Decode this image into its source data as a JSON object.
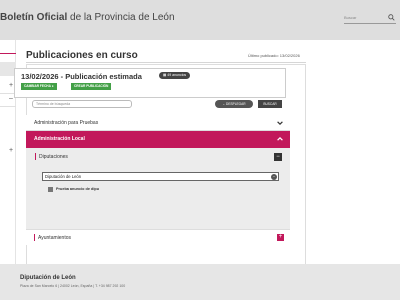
{
  "header": {
    "title_bold": "Boletín Oficial",
    "title_rest": " de la Provincia de León",
    "search_placeholder": "Buscar"
  },
  "sidebar": {
    "symbols": [
      "+",
      "–",
      "+"
    ]
  },
  "main": {
    "title": "Publicaciones en curso",
    "last_publication": "Último publicado: 13/02/2026",
    "card": {
      "date_title": "13/02/2026 - Publicación estimada",
      "count_badge": "49 anuncios",
      "change_date": "CAMBIAR FECHA",
      "create_pub": "CREAR PUBLICACIÓN"
    },
    "filter_placeholder": "Término de búsqueda",
    "desplegar": "DESPLEGAR",
    "buscar": "BUSCAR",
    "sections": {
      "pruebas": "Administración para Pruebas",
      "local": "Administración Local",
      "diputaciones": "Diputaciones",
      "diputacion_leon": "Diputación de León",
      "prueba_anuncio": "Prueba anuncio de dipu",
      "ayuntamientos": "Ayuntamientos"
    }
  },
  "footer": {
    "name": "Diputación de León",
    "address": "Plaza de San Marcelo 6 | 24002 León, España | T. +34 987 292 100"
  },
  "colors": {
    "accent": "#c2185b",
    "green": "#43a047",
    "dark": "#444444"
  }
}
